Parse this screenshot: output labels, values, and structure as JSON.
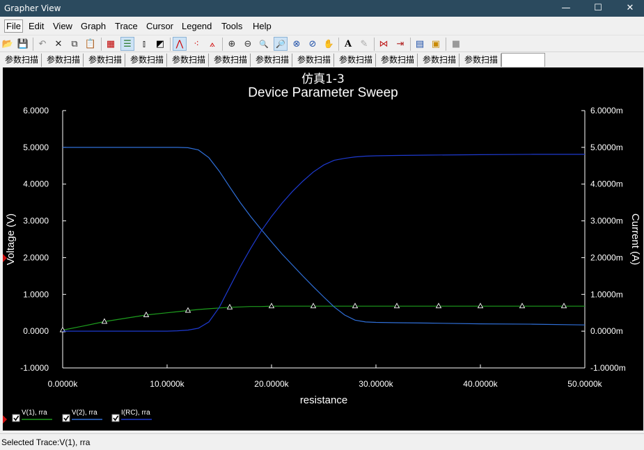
{
  "window": {
    "title": "Grapher View",
    "controls": {
      "minimize": "—",
      "maximize": "☐",
      "close": "✕"
    }
  },
  "menu": [
    "File",
    "Edit",
    "View",
    "Graph",
    "Trace",
    "Cursor",
    "Legend",
    "Tools",
    "Help"
  ],
  "toolbar": [
    {
      "name": "open-icon",
      "glyph": "📂"
    },
    {
      "name": "save-icon",
      "glyph": "💾"
    },
    {
      "name": "undo-icon",
      "glyph": "↶"
    },
    {
      "name": "delete-icon",
      "glyph": "✕"
    },
    {
      "name": "copy-icon",
      "glyph": "⧉"
    },
    {
      "name": "paste-icon",
      "glyph": "📋"
    },
    {
      "name": "grid-icon",
      "glyph": "▦"
    },
    {
      "name": "legend-icon",
      "glyph": "☰"
    },
    {
      "name": "cursor-icon",
      "glyph": "⫾"
    },
    {
      "name": "reverse-colors-icon",
      "glyph": "◩"
    },
    {
      "name": "show-lines-icon",
      "glyph": "⋀"
    },
    {
      "name": "show-points-icon",
      "glyph": "⁖"
    },
    {
      "name": "show-lines-points-icon",
      "glyph": "⟑"
    },
    {
      "name": "zoom-in-icon",
      "glyph": "⊕"
    },
    {
      "name": "zoom-out-icon",
      "glyph": "⊖"
    },
    {
      "name": "zoom-area-icon",
      "glyph": "🔍"
    },
    {
      "name": "zoom-full-icon",
      "glyph": "🔎"
    },
    {
      "name": "zoom-x-icon",
      "glyph": "⊗"
    },
    {
      "name": "zoom-y-icon",
      "glyph": "⊘"
    },
    {
      "name": "pan-icon",
      "glyph": "✋"
    },
    {
      "name": "text-icon",
      "glyph": "A"
    },
    {
      "name": "pen-icon",
      "glyph": "✎"
    },
    {
      "name": "add-trace-icon",
      "glyph": "⋈"
    },
    {
      "name": "export-icon",
      "glyph": "⇥"
    },
    {
      "name": "properties-icon",
      "glyph": "▤"
    },
    {
      "name": "overlay-icon",
      "glyph": "▣"
    },
    {
      "name": "stop-icon",
      "glyph": "■"
    }
  ],
  "tabs": [
    "参数扫描",
    "参数扫描",
    "参数扫描",
    "参数扫描",
    "参数扫描",
    "参数扫描",
    "参数扫描",
    "参数扫描",
    "参数扫描",
    "参数扫描",
    "参数扫描",
    "参数扫描"
  ],
  "colors": {
    "plot_bg": "#000000",
    "axis": "#ffffff",
    "v1": "#1e9e1e",
    "v2": "#2f6fd8",
    "irc": "#1e3ad0"
  },
  "chart_data": {
    "type": "line",
    "title_line1": "仿真1-3",
    "title_line2": "Device Parameter Sweep",
    "xlabel": "resistance",
    "ylabel_left": "Voltage (V)",
    "ylabel_right": "Current (A)",
    "xlim": [
      0,
      50000
    ],
    "ylim": [
      -1,
      6
    ],
    "x_ticks": [
      "0.0000k",
      "10.0000k",
      "20.0000k",
      "30.0000k",
      "40.0000k",
      "50.0000k"
    ],
    "y_ticks_left": [
      "-1.0000",
      "0.0000",
      "1.0000",
      "2.0000",
      "3.0000",
      "4.0000",
      "5.0000",
      "6.0000"
    ],
    "y_ticks_right": [
      "-1.0000m",
      "0.0000m",
      "1.0000m",
      "2.0000m",
      "3.0000m",
      "4.0000m",
      "5.0000m",
      "6.0000m"
    ],
    "grid": false,
    "legend": "bottom-left",
    "x": [
      0,
      2000,
      4000,
      6000,
      8000,
      10000,
      11000,
      12000,
      13000,
      14000,
      15000,
      16000,
      17000,
      18000,
      19000,
      20000,
      21000,
      22000,
      23000,
      24000,
      25000,
      26000,
      27000,
      28000,
      29000,
      30000,
      32000,
      35000,
      40000,
      45000,
      50000
    ],
    "series": [
      {
        "name": "V(1), rra",
        "axis": "left",
        "markers": true,
        "values": [
          0.03,
          0.14,
          0.26,
          0.35,
          0.44,
          0.5,
          0.53,
          0.56,
          0.59,
          0.61,
          0.63,
          0.65,
          0.66,
          0.67,
          0.67,
          0.68,
          0.68,
          0.68,
          0.68,
          0.68,
          0.68,
          0.68,
          0.68,
          0.68,
          0.68,
          0.68,
          0.68,
          0.68,
          0.68,
          0.68,
          0.68
        ]
      },
      {
        "name": "V(2), rra",
        "axis": "left",
        "markers": false,
        "values": [
          5.0,
          5.0,
          5.0,
          5.0,
          5.0,
          5.0,
          5.0,
          4.99,
          4.93,
          4.72,
          4.35,
          3.92,
          3.5,
          3.12,
          2.77,
          2.43,
          2.1,
          1.8,
          1.5,
          1.21,
          0.93,
          0.66,
          0.44,
          0.3,
          0.25,
          0.24,
          0.23,
          0.22,
          0.2,
          0.19,
          0.17
        ]
      },
      {
        "name": "I(RC), rra",
        "axis": "right",
        "markers": false,
        "values": [
          0.0,
          0.0,
          0.0,
          0.0,
          0.0,
          0.0,
          0.01,
          0.03,
          0.08,
          0.25,
          0.65,
          1.2,
          1.75,
          2.25,
          2.72,
          3.12,
          3.48,
          3.8,
          4.08,
          4.33,
          4.52,
          4.65,
          4.7,
          4.74,
          4.76,
          4.77,
          4.78,
          4.79,
          4.8,
          4.81,
          4.81
        ]
      }
    ]
  },
  "status": {
    "text": "Selected Trace:V(1), rra"
  }
}
